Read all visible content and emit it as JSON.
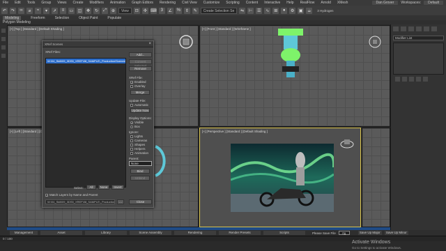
{
  "menubar": {
    "items": [
      "File",
      "Edit",
      "Tools",
      "Group",
      "Views",
      "Create",
      "Modifiers",
      "Animation",
      "Graph Editors",
      "Rendering",
      "Civil View",
      "Customize",
      "Scripting",
      "Content",
      "Interactive",
      "Help",
      "RealFlow",
      "Arnold",
      "XMesh"
    ],
    "user": "Dan Grover",
    "workspaces_label": "Workspaces:",
    "workspace": "Default"
  },
  "toolbar": {
    "view_select": "View",
    "selection_set": "Create Selection Se",
    "hydrogen": "3 Hydrogen"
  },
  "ribbon": {
    "tabs": [
      "Modeling",
      "Freeform",
      "Selection",
      "Object Paint",
      "Populate"
    ],
    "subtitle": "Polygon Modeling"
  },
  "viewports": {
    "top": "[+] [Top ] [Standard ] [Default Shading ]",
    "front": "[+] [Front ] [Standard ] [Wireframe ]",
    "left": "[+] [Left ] [Standard ] [Default Shading ]",
    "perspective": "[+] [Perspective ] [Standard ] [Default Shading ]"
  },
  "cmdpanel": {
    "modifier_list": "Modifier List"
  },
  "dialog": {
    "title": "XRef Scenes",
    "xref_files_label": "XRef Files:",
    "selected_file": "W:\\04_Skill\\09_3DS5_XREF\\08_SAMPLE\\_Production\\Scenes\\Rat_Master.max",
    "add": "Add...",
    "convert_selected": "Convert Selected",
    "remove": "Remove",
    "xref_file_label": "XRef File:",
    "enabled": "Enabled",
    "overlay": "Overlay",
    "merge": "Merge",
    "update_file_label": "Update File:",
    "automatic": "Automatic",
    "update_now": "Update Now",
    "display_options_label": "Display Options:",
    "visible": "Visible",
    "box": "Box",
    "ignore_label": "Ignore:",
    "lights": "Lights",
    "cameras": "Cameras",
    "shapes": "Shapes",
    "helpers": "Helpers",
    "animation": "Animation",
    "parent_label": "Parent:",
    "parent_value": "None",
    "bind": "Bind",
    "unbind": "Unbind",
    "select_label": "Select:",
    "all": "All",
    "none": "None",
    "invert": "Invert",
    "match_layers": "Match Layers by Name and Parent",
    "path": "W:\\04_Skill\\09_3DS5_XREF\\08_SAMPLE\\_Production\\Sc",
    "browse": "...",
    "close": "Close"
  },
  "bottomtabs": {
    "items": [
      "Management",
      "Asset",
      "Library",
      "Scene Assembly",
      "Rendering",
      "Render Presets",
      "Scripts"
    ],
    "please_save": "Please Save File",
    "save_field": "0g",
    "save_up_major": "Save Up Major",
    "save_up_minor": "Save Up Minor"
  },
  "trackbar": {
    "frame": "0 / 100"
  },
  "watermark": {
    "title": "Activate Windows",
    "subtitle": "Go to Settings to activate Windows."
  }
}
